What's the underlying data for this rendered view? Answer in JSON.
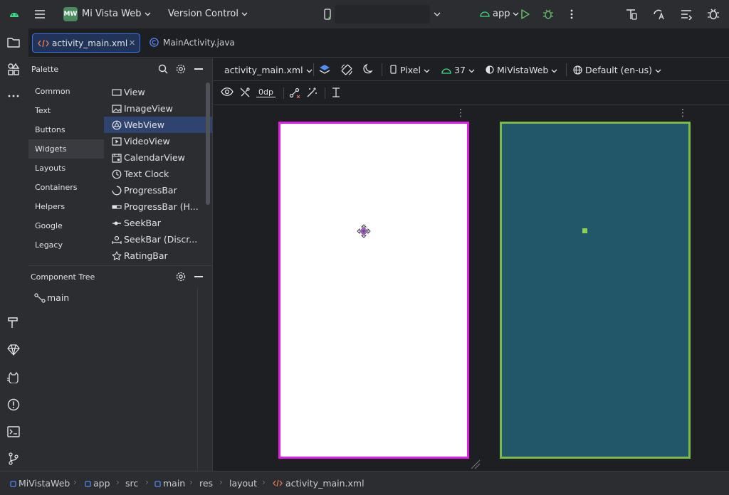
{
  "titlebar": {
    "project_badge": "MW",
    "project_name": "Mi Vista Web",
    "vcs_label": "Version Control",
    "run_config": "app"
  },
  "editor_tabs": [
    {
      "label": "activity_main.xml",
      "active": true
    },
    {
      "label": "MainActivity.java",
      "active": false
    }
  ],
  "palette": {
    "title": "Palette",
    "categories": [
      "Common",
      "Text",
      "Buttons",
      "Widgets",
      "Layouts",
      "Containers",
      "Helpers",
      "Google",
      "Legacy"
    ],
    "selected_category": "Widgets",
    "widgets": [
      "View",
      "ImageView",
      "WebView",
      "VideoView",
      "CalendarView",
      "Text Clock",
      "ProgressBar",
      "ProgressBar (H...",
      "SeekBar",
      "SeekBar (Discr...",
      "RatingBar"
    ],
    "selected_widget": "WebView"
  },
  "component_tree": {
    "title": "Component Tree",
    "root": "main"
  },
  "design_toolbar": {
    "file": "activity_main.xml",
    "device": "Pixel",
    "api": "37",
    "theme": "MiVistaWeb",
    "locale": "Default (en-us)",
    "default_margin": "0dp"
  },
  "breadcrumb": [
    "MiVistaWeb",
    "app",
    "src",
    "main",
    "res",
    "layout",
    "activity_main.xml"
  ],
  "colors": {
    "accent": "#3574f0",
    "selection_magenta": "#e21ee0",
    "blueprint_bg": "#225669",
    "blueprint_border": "#7db84a",
    "run_green": "#5fb865"
  }
}
